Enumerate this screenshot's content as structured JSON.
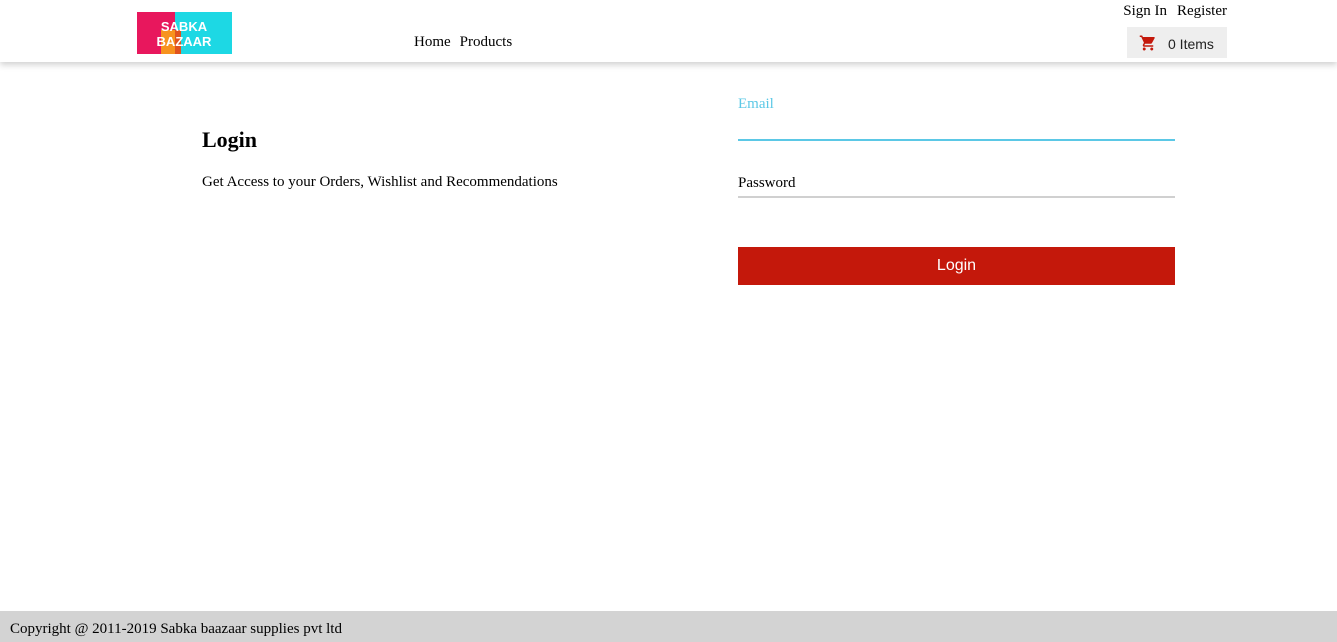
{
  "header": {
    "logo": {
      "line1": "SABKA",
      "line2": "BAZAAR",
      "colors": [
        "#e8175d",
        "#f7931e",
        "#1dd8e4"
      ]
    },
    "nav": [
      {
        "label": "Home"
      },
      {
        "label": "Products"
      }
    ],
    "auth": {
      "sign_in": "Sign In",
      "register": "Register"
    },
    "cart": {
      "icon": "cart-icon",
      "label": "0 Items",
      "icon_color": "#c4180b"
    }
  },
  "main": {
    "title": "Login",
    "description": "Get Access to your Orders, Wishlist and Recommendations",
    "email": {
      "label": "Email",
      "value": "",
      "accent_color": "#5bc8e6"
    },
    "password": {
      "label": "Password",
      "value": ""
    },
    "submit_label": "Login",
    "submit_color": "#c4180b"
  },
  "footer": {
    "copyright": "Copyright @ 2011-2019 Sabka baazaar supplies pvt ltd"
  }
}
